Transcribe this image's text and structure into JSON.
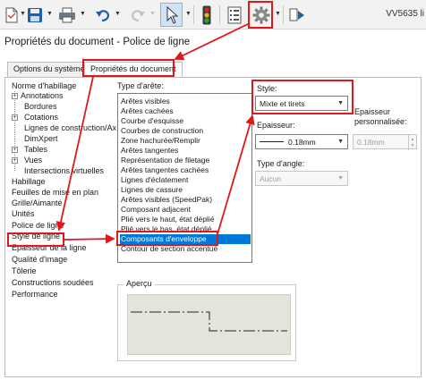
{
  "toolbar": {
    "title_fragment": "VV5635 li",
    "icons": [
      "new-doc-icon",
      "save-icon",
      "print-icon",
      "undo-icon",
      "redo-icon",
      "select-arrow-icon",
      "traffic-light-icon",
      "file-properties-icon",
      "options-gear-icon",
      "view-icon"
    ]
  },
  "dialog": {
    "title": "Propriétés du document - Police de ligne",
    "tabs": [
      "Options du système",
      "Propriétés du document"
    ]
  },
  "tree": {
    "items": [
      {
        "label": "Norme d'habillage",
        "level": 0
      },
      {
        "label": "Annotations",
        "level": 1,
        "expander": true
      },
      {
        "label": "Bordures",
        "level": 1
      },
      {
        "label": "Cotations",
        "level": 1,
        "expander": true
      },
      {
        "label": "Lignes de construction/Ax",
        "level": 1
      },
      {
        "label": "DimXpert",
        "level": 1
      },
      {
        "label": "Tables",
        "level": 1,
        "expander": true
      },
      {
        "label": "Vues",
        "level": 1,
        "expander": true
      },
      {
        "label": "Intersections virtuelles",
        "level": 1
      },
      {
        "label": "Habillage",
        "level": 0
      },
      {
        "label": "Feuilles de mise en plan",
        "level": 0
      },
      {
        "label": "Grille/Aimanté",
        "level": 0
      },
      {
        "label": "Unités",
        "level": 0
      },
      {
        "label": "Police de ligne",
        "level": 0,
        "selected": true
      },
      {
        "label": "Style de ligne",
        "level": 0
      },
      {
        "label": "Epaisseur de la ligne",
        "level": 0
      },
      {
        "label": "Qualité d'image",
        "level": 0
      },
      {
        "label": "Tôlerie",
        "level": 0
      },
      {
        "label": "Constructions soudées",
        "level": 0
      },
      {
        "label": "Performance",
        "level": 0
      }
    ]
  },
  "edge_type": {
    "label": "Type d'arête:",
    "items": [
      "Arêtes visibles",
      "Arêtes cachées",
      "Courbe d'esquisse",
      "Courbes de construction",
      "Zone hachurée/Remplir",
      "Arêtes tangentes",
      "Représentation de filetage",
      "Arêtes tangentes cachées",
      "Lignes d'éclatement",
      "Lignes de cassure",
      "Arêtes visibles (SpeedPak)",
      "Composant adjacent",
      "Plié vers le haut, état déplié",
      "Plié vers le bas, état déplié",
      "Composants d'enveloppe",
      "Contour de section accentué"
    ],
    "selected_index": 14
  },
  "style": {
    "label": "Style:",
    "value": "Mixte et tirets"
  },
  "thickness": {
    "label": "Epaisseur:",
    "value": "0.18mm"
  },
  "custom_thickness": {
    "label": "Epaisseur personnalisée:",
    "value": "0.18mm"
  },
  "end_type": {
    "label": "Type d'angle:",
    "value": "Aucun"
  },
  "preview": {
    "label": "Aperçu"
  },
  "colors": {
    "accent": "#e0181b",
    "selection": "#0078d7",
    "preview_bg": "#e5e4dc"
  }
}
